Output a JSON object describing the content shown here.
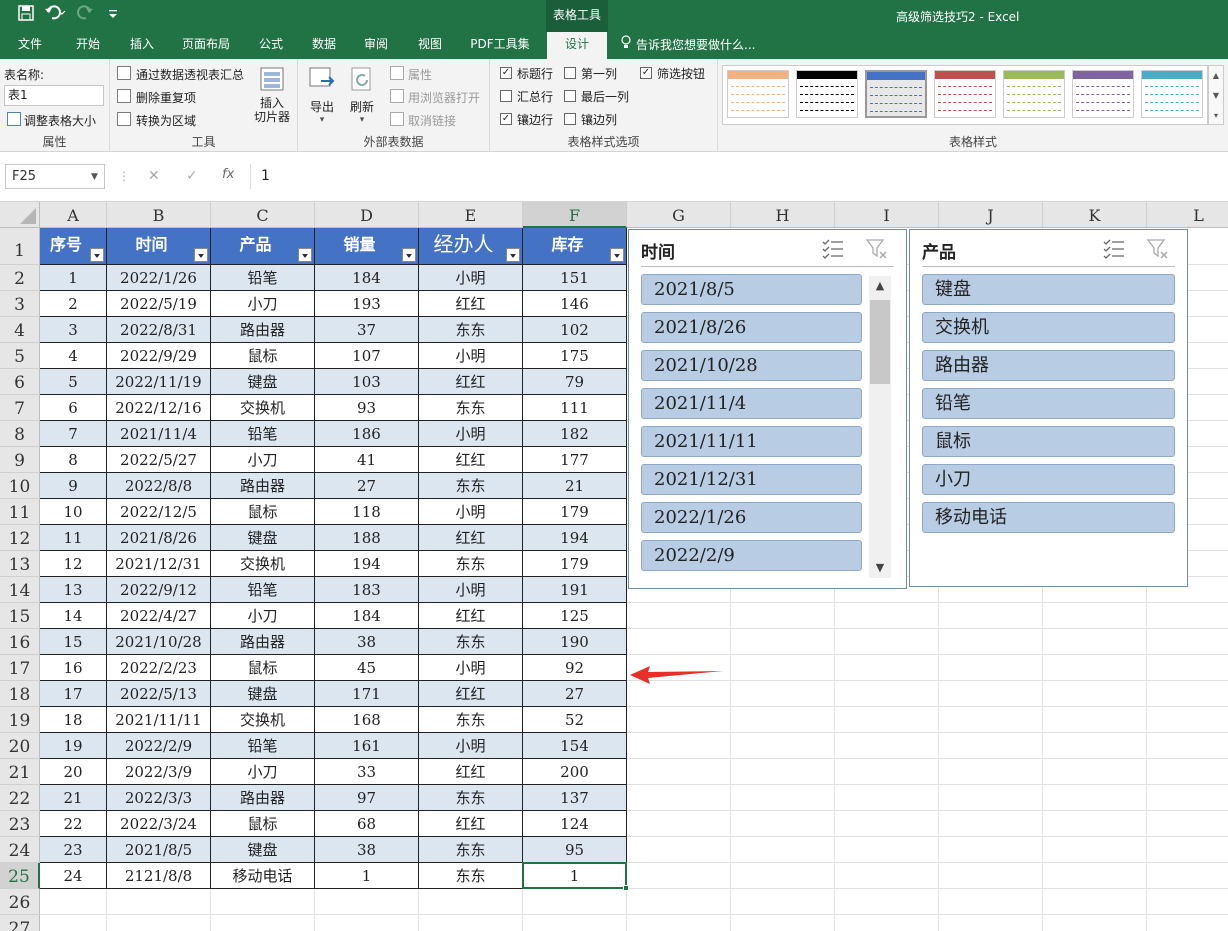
{
  "titlebar": {
    "doc_title": "高级筛选技巧2 - Excel",
    "context_tab": "表格工具"
  },
  "qat": {
    "icons": [
      "save-icon",
      "undo-icon",
      "redo-icon",
      "customize-icon"
    ]
  },
  "tabs": [
    "文件",
    "开始",
    "插入",
    "页面布局",
    "公式",
    "数据",
    "审阅",
    "视图",
    "PDF工具集",
    "设计"
  ],
  "active_tab": "设计",
  "tell_me": "告诉我您想要做什么...",
  "ribbon": {
    "props": {
      "name_label": "表名称:",
      "name_value": "表1",
      "resize": "调整表格大小",
      "group": "属性"
    },
    "tools": {
      "pivot": "通过数据透视表汇总",
      "remove_dup": "删除重复项",
      "to_range": "转换为区域",
      "slicer": "插入\n切片器",
      "group": "工具"
    },
    "external": {
      "export": "导出",
      "refresh": "刷新",
      "properties": "属性",
      "open_browser": "用浏览器打开",
      "unlink": "取消链接",
      "group": "外部表数据"
    },
    "style_options": {
      "header_row": "标题行",
      "total_row": "汇总行",
      "banded_rows": "镶边行",
      "first_col": "第一列",
      "last_col": "最后一列",
      "banded_cols": "镶边列",
      "filter_btn": "筛选按钮",
      "group": "表格样式选项",
      "checked": {
        "header_row": true,
        "total_row": false,
        "banded_rows": true,
        "first_col": false,
        "last_col": false,
        "banded_cols": false,
        "filter_btn": true
      }
    },
    "styles": {
      "group": "表格样式",
      "colors": [
        "#f4b183",
        "#000000",
        "#4472c4",
        "#c0504d",
        "#9bbb59",
        "#8064a2",
        "#4bacc6"
      ]
    }
  },
  "formula_bar": {
    "name_box": "F25",
    "formula": "1",
    "fx": "fx"
  },
  "columns": [
    "A",
    "B",
    "C",
    "D",
    "E",
    "F",
    "G",
    "H",
    "I",
    "J",
    "K",
    "L"
  ],
  "selected_column": "F",
  "rows": [
    "1",
    "2",
    "3",
    "4",
    "5",
    "6",
    "7",
    "8",
    "9",
    "10",
    "11",
    "12",
    "13",
    "14",
    "15",
    "16",
    "17",
    "18",
    "19",
    "20",
    "21",
    "22",
    "23",
    "24",
    "25",
    "26",
    "27"
  ],
  "selected_row": "25",
  "table": {
    "headers": [
      "序号",
      "时间",
      "产品",
      "销量",
      "经办人",
      "库存"
    ],
    "rows": [
      [
        "1",
        "2022/1/26",
        "铅笔",
        "184",
        "小明",
        "151"
      ],
      [
        "2",
        "2022/5/19",
        "小刀",
        "193",
        "红红",
        "146"
      ],
      [
        "3",
        "2022/8/31",
        "路由器",
        "37",
        "东东",
        "102"
      ],
      [
        "4",
        "2022/9/29",
        "鼠标",
        "107",
        "小明",
        "175"
      ],
      [
        "5",
        "2022/11/19",
        "键盘",
        "103",
        "红红",
        "79"
      ],
      [
        "6",
        "2022/12/16",
        "交换机",
        "93",
        "东东",
        "111"
      ],
      [
        "7",
        "2021/11/4",
        "铅笔",
        "186",
        "小明",
        "182"
      ],
      [
        "8",
        "2022/5/27",
        "小刀",
        "41",
        "红红",
        "177"
      ],
      [
        "9",
        "2022/8/8",
        "路由器",
        "27",
        "东东",
        "21"
      ],
      [
        "10",
        "2022/12/5",
        "鼠标",
        "118",
        "小明",
        "179"
      ],
      [
        "11",
        "2021/8/26",
        "键盘",
        "188",
        "红红",
        "194"
      ],
      [
        "12",
        "2021/12/31",
        "交换机",
        "194",
        "东东",
        "179"
      ],
      [
        "13",
        "2022/9/12",
        "铅笔",
        "183",
        "小明",
        "191"
      ],
      [
        "14",
        "2022/4/27",
        "小刀",
        "184",
        "红红",
        "125"
      ],
      [
        "15",
        "2021/10/28",
        "路由器",
        "38",
        "东东",
        "190"
      ],
      [
        "16",
        "2022/2/23",
        "鼠标",
        "45",
        "小明",
        "92"
      ],
      [
        "17",
        "2022/5/13",
        "键盘",
        "171",
        "红红",
        "27"
      ],
      [
        "18",
        "2021/11/11",
        "交换机",
        "168",
        "东东",
        "52"
      ],
      [
        "19",
        "2022/2/9",
        "铅笔",
        "161",
        "小明",
        "154"
      ],
      [
        "20",
        "2022/3/9",
        "小刀",
        "33",
        "红红",
        "200"
      ],
      [
        "21",
        "2022/3/3",
        "路由器",
        "97",
        "东东",
        "137"
      ],
      [
        "22",
        "2022/3/24",
        "鼠标",
        "68",
        "红红",
        "124"
      ],
      [
        "23",
        "2021/8/5",
        "键盘",
        "38",
        "东东",
        "95"
      ],
      [
        "24",
        "2121/8/8",
        "移动电话",
        "1",
        "东东",
        "1"
      ]
    ]
  },
  "slicer_time": {
    "title": "时间",
    "items": [
      "2021/8/5",
      "2021/8/26",
      "2021/10/28",
      "2021/11/4",
      "2021/11/11",
      "2021/12/31",
      "2022/1/26",
      "2022/2/9"
    ]
  },
  "slicer_product": {
    "title": "产品",
    "items": [
      "键盘",
      "交换机",
      "路由器",
      "铅笔",
      "鼠标",
      "小刀",
      "移动电话"
    ]
  },
  "annotation": {
    "arrow_color": "#e8302a"
  }
}
